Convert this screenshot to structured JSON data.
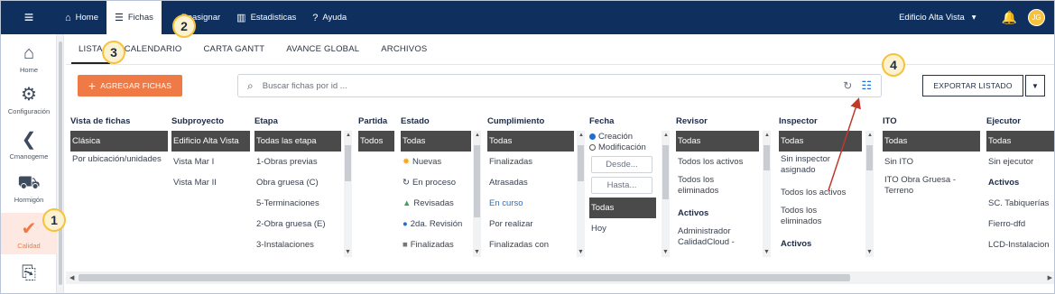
{
  "topbar": {
    "nav": [
      {
        "label": "Home",
        "icon": "home-icon",
        "glyph": "⌂"
      },
      {
        "label": "Fichas",
        "icon": "list-icon",
        "glyph": "☰"
      },
      {
        "label": "Reasignar",
        "icon": "reassign-icon",
        "glyph": ""
      },
      {
        "label": "Estadisticas",
        "icon": "chart-icon",
        "glyph": "▥"
      },
      {
        "label": "Ayuda",
        "icon": "help-icon",
        "glyph": "?"
      }
    ],
    "project": "Edificio Alta Vista",
    "avatar": "JG"
  },
  "sidebar": {
    "items": [
      {
        "label": "Home",
        "icon": "home-icon"
      },
      {
        "label": "Configuración",
        "icon": "gear-icon"
      },
      {
        "label": "Cmanogeme",
        "icon": "bookmark-icon"
      },
      {
        "label": "Hormigón",
        "icon": "truck-icon"
      },
      {
        "label": "Calidad",
        "icon": "check-icon"
      },
      {
        "label": "",
        "icon": "doc-arrow-icon"
      }
    ]
  },
  "tabs": [
    "LISTA",
    "CALENDARIO",
    "CARTA GANTT",
    "AVANCE GLOBAL",
    "ARCHIVOS"
  ],
  "toolbar": {
    "add_label": "AGREGAR FICHAS",
    "search_placeholder": "Buscar fichas por id ...",
    "export_label": "EXPORTAR LISTADO"
  },
  "filters": {
    "vista": {
      "title": "Vista de fichas",
      "options": [
        "Clásica",
        "Por ubicación/unidades"
      ]
    },
    "subproyecto": {
      "title": "Subproyecto",
      "options": [
        "Edificio Alta Vista",
        "Vista Mar I",
        "Vista Mar II"
      ]
    },
    "etapa": {
      "title": "Etapa",
      "options": [
        "Todas las etapa",
        "1-Obras previas",
        "Obra gruesa (C)",
        "5-Terminaciones",
        "2-Obra gruesa (E)",
        "3-Instalaciones"
      ]
    },
    "partida": {
      "title": "Partida",
      "options": [
        "Todos"
      ]
    },
    "estado": {
      "title": "Estado",
      "options": [
        "Todas",
        "Nuevas",
        "En proceso",
        "Revisadas",
        "2da. Revisión",
        "Finalizadas"
      ]
    },
    "cumplimiento": {
      "title": "Cumplimiento",
      "options": [
        "Todas",
        "Finalizadas",
        "Atrasadas",
        "En curso",
        "Por realizar",
        "Finalizadas con"
      ]
    },
    "fecha": {
      "title": "Fecha",
      "radio": [
        "Creación",
        "Modificación"
      ],
      "desde": "Desde...",
      "hasta": "Hasta...",
      "options": [
        "Todas",
        "Hoy"
      ]
    },
    "revisor": {
      "title": "Revisor",
      "options": [
        "Todas",
        "Todos los activos",
        "Todos los eliminados",
        "Activos",
        "Administrador CalidadCloud -"
      ]
    },
    "inspector": {
      "title": "Inspector",
      "options": [
        "Todas",
        "Sin inspector asignado",
        "Todos los activos",
        "Todos los eliminados",
        "Activos"
      ]
    },
    "ito": {
      "title": "ITO",
      "options": [
        "Todas",
        "Sin ITO",
        "ITO Obra Gruesa - Terreno"
      ]
    },
    "ejecutor": {
      "title": "Ejecutor",
      "options": [
        "Todas",
        "Sin ejecutor",
        "Activos",
        "SC. Tabiquerías",
        "Fierro-dfd",
        "LCD-Instalacion"
      ]
    }
  },
  "callouts": [
    "1",
    "2",
    "3",
    "4"
  ],
  "colors": {
    "navbar": "#0f2f5f",
    "accent": "#f07a46",
    "callout": "#f6c23b",
    "selected": "#4a4a4a",
    "link": "#1f6fd1"
  }
}
